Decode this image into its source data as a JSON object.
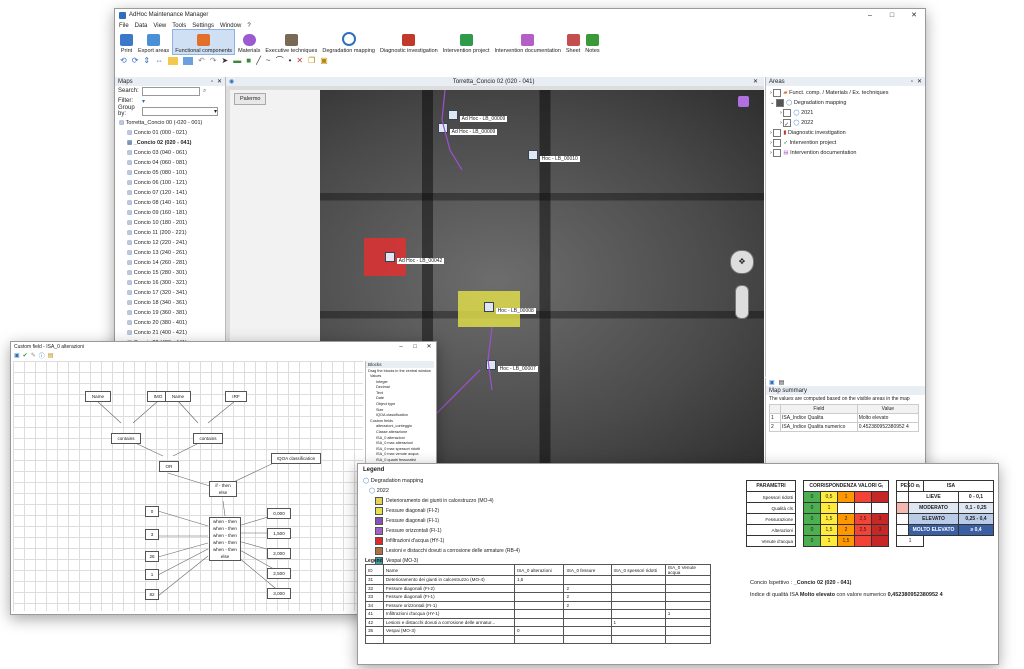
{
  "app": {
    "title": "AdHoc Maintenance Manager",
    "menu": [
      "File",
      "Data",
      "View",
      "Tools",
      "Settings",
      "Window",
      "?"
    ],
    "ribbon": [
      {
        "label": "Print",
        "color": "#3c78c8"
      },
      {
        "label": "Export areas",
        "color": "#4b8fd6"
      },
      {
        "label": "Functional components",
        "color": "#e0702a"
      },
      {
        "label": "Materials",
        "color": "#9b5ad0"
      },
      {
        "label": "Executive techniques",
        "color": "#7a6a55"
      },
      {
        "label": "Degradation mapping",
        "color": "#2f6fc0"
      },
      {
        "label": "Diagnostic investigation",
        "color": "#c0392b"
      },
      {
        "label": "Intervention project",
        "color": "#2f9a4a"
      },
      {
        "label": "Intervention documentation",
        "color": "#b35fc5"
      },
      {
        "label": "Sheet",
        "color": "#c44e4e"
      },
      {
        "label": "Notes",
        "color": "#3a9a3a"
      }
    ]
  },
  "maps_panel": {
    "title": "Maps",
    "search_label": "Search:",
    "filter_label": "Filter:",
    "groupby_label": "Group by:",
    "items": [
      "Torretta_Concio 00 (-020 - 001)",
      "Concio 01 (000 - 021)",
      "_Concio 02 (020 - 041)",
      "Concio 03 (040 - 061)",
      "Concio 04 (060 - 081)",
      "Concio 05 (080 - 101)",
      "Concio 06 (100 - 121)",
      "Concio 07 (120 - 141)",
      "Concio 08 (140 - 161)",
      "Concio 09 (160 - 181)",
      "Concio 10 (180 - 201)",
      "Concio 11 (200 - 221)",
      "Concio 12 (220 - 241)",
      "Concio 13 (240 - 261)",
      "Concio 14 (260 - 281)",
      "Concio 15 (280 - 301)",
      "Concio 16 (300 - 321)",
      "Concio 17 (320 - 341)",
      "Concio 18 (340 - 361)",
      "Concio 19 (360 - 381)",
      "Concio 20 (380 - 401)",
      "Concio 21 (400 - 421)",
      "Concio 22 (420 - 441)",
      "Concio 23 (440 - 461)",
      "Concio 24 (460 - 481)",
      "Concio 25 (480 - 501)",
      "Concio 26 (500 - 521)"
    ]
  },
  "map_view": {
    "tab_title": "Torretta_Concio 02 (020 - 041)",
    "location_button": "Palermo",
    "markers": [
      {
        "label": "Ad Hoc - LB_00009",
        "fill": "none"
      },
      {
        "label": "Ad Hoc - LB_00009",
        "fill": "none"
      },
      {
        "label": "Hoc - LB_00010",
        "fill": "none"
      },
      {
        "label": "Ad Hoc - LB_00042",
        "fill": "#e03030"
      },
      {
        "label": "Hoc - LB_00008",
        "fill": "#e6e24a"
      },
      {
        "label": "Hoc - LB_00007",
        "fill": "none"
      }
    ]
  },
  "areas_panel": {
    "title": "Areas",
    "items": [
      "Funct. comp. / Materials / Ex. techniques",
      "Degradation mapping",
      "2021",
      "2022",
      "Diagnostic investigation",
      "Intervention project",
      "Intervention documentation"
    ]
  },
  "summary_panel": {
    "title": "Map summary",
    "note": "The values are computed based on the visible areas in the map",
    "col_field": "Field",
    "col_value": "Value",
    "rows": [
      {
        "n": "1",
        "field": "ISA_Indice Qualita",
        "value": "Molto elevato"
      },
      {
        "n": "2",
        "field": "ISA_Indice Qualita numerico",
        "value": "0.452380952380952 4"
      }
    ]
  },
  "custom_field": {
    "title": "Custom field - ISA_0 alterazioni",
    "blocks_title": "Blocks",
    "blocks_hint": "Drag the blocks in the central window",
    "blocks": [
      "Values",
      "Integer",
      "Decimal",
      "Text",
      "Date",
      "Object type",
      "Size",
      "IQOA classification",
      "Custom fields",
      "alterazioni_conteggio",
      "Classe alterazione",
      "ISA_0 alterazioni",
      "ISA_0 max alterazioni",
      "ISA_0 max spessori ridotti",
      "ISA_0 max venute acqua",
      "ISA_0 quadri fessurativi",
      "ISA_0 stato alterazioni",
      "ISA_0 spessori ridotti",
      "ISA_0 venute acqua",
      "ISA_0 fessure",
      "ISA_denominazione"
    ],
    "nodes": {
      "name1": "Name",
      "imo": "IMO",
      "name2": "Name",
      "irf": "IRF",
      "contains": "contains",
      "or": "OR",
      "iqoa": "IQOA classification",
      "ifthen": "if - then",
      "else": "else",
      "when": [
        "when - then",
        "when - then",
        "when - then",
        "when - then",
        "when - then",
        "else"
      ],
      "left_vals": [
        "0",
        "3",
        "26",
        "1",
        "82"
      ],
      "right_vals": [
        "0,000",
        "1,500",
        "2,000",
        "2,500",
        "3,000"
      ]
    }
  },
  "legend_doc": {
    "legend_title": "Legend",
    "tree_root": "Degradation mapping",
    "tree_year": "2022",
    "entries": [
      {
        "color": "#e6d35a",
        "text": "Deterioramento dei giunti in calcestruzzo (MO-4)"
      },
      {
        "color": "#e6e24a",
        "text": "Fessure diagonali (FI-2)"
      },
      {
        "color": "#8a4fb8",
        "text": "Fessure diagonali (FI-1)"
      },
      {
        "color": "#a55fc8",
        "text": "Fessure orizzontali (FI-1)"
      },
      {
        "color": "#e02a2a",
        "text": "Infiltrazioni d'acqua (HY-1)"
      },
      {
        "color": "#b07040",
        "text": "Lesioni e distacchi dovuti a corrosione delle armature (RB-4)"
      },
      {
        "color": "#3aa0a0",
        "text": "Vespai (MO-3)"
      }
    ],
    "table_title": "Legend",
    "table_headers": [
      "ID",
      "Name",
      "ISA_0 alterazioni",
      "ISA_0 fessure",
      "ISA_0 spessori ridotti",
      "ISA_0 Venute acqua"
    ],
    "table_rows": [
      [
        "31",
        "Deterioramento dei giunti in calcestruzzo (MO-4)",
        "1,5",
        "",
        "",
        ""
      ],
      [
        "32",
        "Fessure diagonali (FI-2)",
        "",
        "2",
        "",
        ""
      ],
      [
        "33",
        "Fessure diagonali (FI-1)",
        "",
        "2",
        "",
        ""
      ],
      [
        "34",
        "Fessure orizzontali (FI-1)",
        "",
        "2",
        "",
        ""
      ],
      [
        "41",
        "Infiltrazioni d'acqua (HY-1)",
        "",
        "",
        "",
        "1"
      ],
      [
        "42",
        "Lesioni e distacchi dovuti a corrosione delle armatur...",
        "",
        "",
        "1",
        ""
      ],
      [
        "35",
        "Vespai (MO-3)",
        "0",
        "",
        "",
        ""
      ]
    ],
    "param_headers": [
      "PARAMETRI",
      "CORRISPONDENZA VALORI Gᵢ",
      "PESO αᵢ",
      "ISA"
    ],
    "params": [
      {
        "name": "Spessori ridotti",
        "vals": [
          "0",
          "0,5",
          "1",
          "",
          ""
        ],
        "peso": "1"
      },
      {
        "name": "Qualità cls",
        "vals": [
          "0",
          "1",
          "",
          "",
          ""
        ],
        "peso": "?"
      },
      {
        "name": "Fessurazione",
        "vals": [
          "0",
          "1,5",
          "2",
          "2,5",
          "3"
        ],
        "peso": "1"
      },
      {
        "name": "Alterazioni",
        "vals": [
          "0",
          "1,5",
          "2",
          "2,5",
          "3"
        ],
        "peso": "1"
      },
      {
        "name": "Venute d'acqua",
        "vals": [
          "0",
          "1",
          "1,5",
          "",
          ""
        ],
        "peso": "1"
      }
    ],
    "isa_levels": [
      {
        "label": "LIEVE",
        "range": "0 - 0,1",
        "color": "#ffffff"
      },
      {
        "label": "MODERATO",
        "range": "0,1 - 0,25",
        "color": "#dfe7f3"
      },
      {
        "label": "ELEVATO",
        "range": "0,25 - 0,4",
        "color": "#b9cbe6"
      },
      {
        "label": "MOLTO ELEVATO",
        "range": "≥ 0,4",
        "color": "#3b5fa3"
      }
    ],
    "concio_label": "Concio Ispettivo :",
    "concio_value": "_Concio 02 (020 - 041)",
    "isa_line_prefix": "Indice di qualità ISA",
    "isa_line_level": "Molto elevato",
    "isa_line_mid": "con valore numerico",
    "isa_line_value": "0,452380952380952 4"
  }
}
